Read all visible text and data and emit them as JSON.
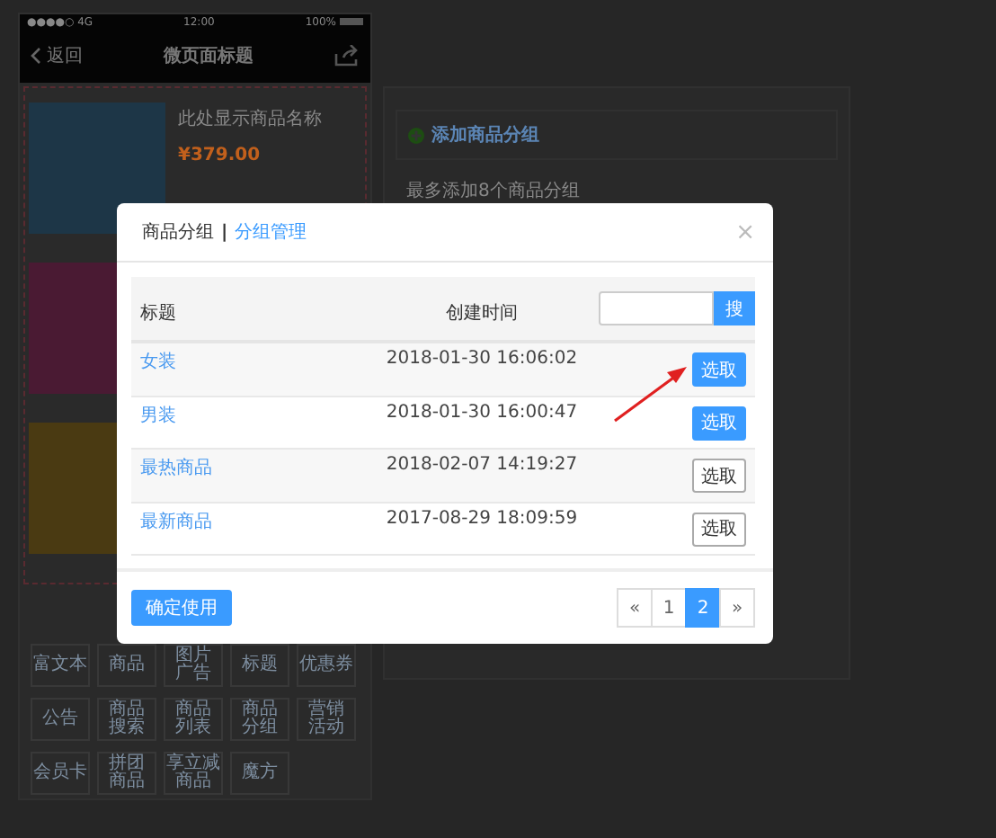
{
  "phone": {
    "status": {
      "signal": "●●●●○ 4G",
      "time": "12:00",
      "battery": "100%"
    },
    "nav": {
      "back": "返回",
      "title": "微页面标题"
    },
    "products": [
      {
        "color": "#1d3647",
        "name": "此处显示商品名称",
        "price": "¥379.00"
      },
      {
        "color": "#4a1a33"
      },
      {
        "color": "#4a3a12"
      }
    ],
    "components": [
      [
        "富文本"
      ],
      [
        "商品"
      ],
      [
        "图片",
        "广告"
      ],
      [
        "标题"
      ],
      [
        "优惠券"
      ],
      [
        "公告"
      ],
      [
        "商品",
        "搜索"
      ],
      [
        "商品",
        "列表"
      ],
      [
        "商品",
        "分组"
      ],
      [
        "营销",
        "活动"
      ],
      [
        "会员卡"
      ],
      [
        "拼团",
        "商品"
      ],
      [
        "享立减",
        "商品"
      ],
      [
        "魔方"
      ]
    ]
  },
  "panel": {
    "add_button": "添加商品分组",
    "hint": "最多添加8个商品分组"
  },
  "modal": {
    "tabs": [
      {
        "label": "商品分组",
        "selected": true
      },
      {
        "label": "分组管理",
        "selected": false
      }
    ],
    "separator": "|",
    "close": "×",
    "columns": [
      "标题",
      "创建时间"
    ],
    "search": {
      "button": "搜"
    },
    "rows": [
      {
        "title": "女装",
        "time": "2018-01-30 16:06:02",
        "action": "选取",
        "selected": true
      },
      {
        "title": "男装",
        "time": "2018-01-30 16:00:47",
        "action": "选取",
        "selected": true
      },
      {
        "title": "最热商品",
        "time": "2018-02-07 14:19:27",
        "action": "选取",
        "selected": false
      },
      {
        "title": "最新商品",
        "time": "2017-08-29 18:09:59",
        "action": "选取",
        "selected": false
      }
    ],
    "confirm": "确定使用",
    "pagination": [
      {
        "label": "«",
        "selected": false
      },
      {
        "label": "1",
        "selected": false
      },
      {
        "label": "2",
        "selected": true
      },
      {
        "label": "»",
        "selected": false
      }
    ]
  }
}
